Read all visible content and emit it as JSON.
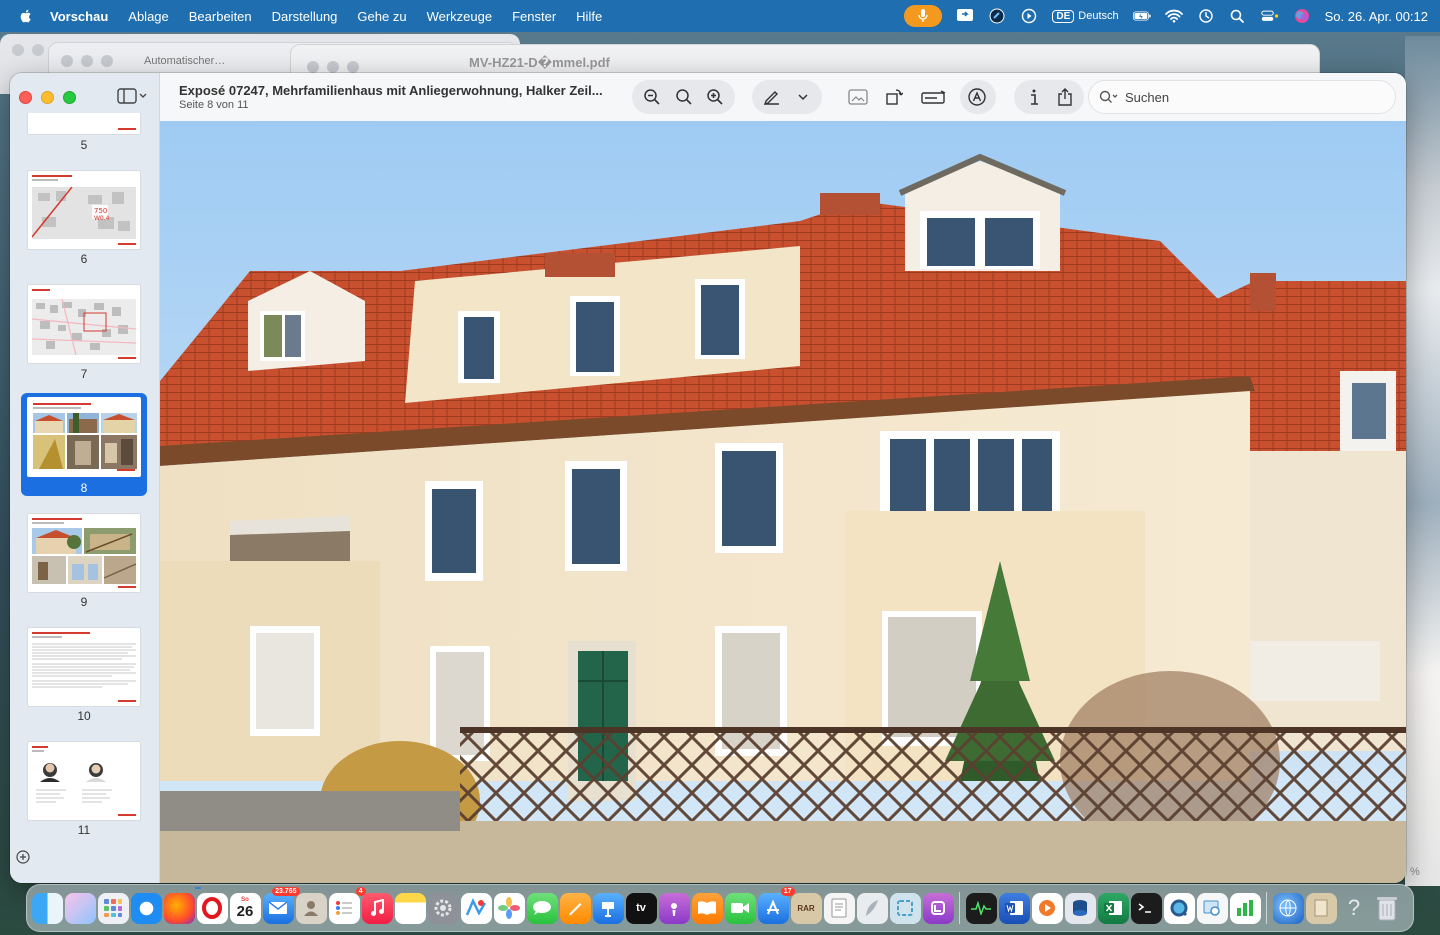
{
  "menubar": {
    "app_name": "Vorschau",
    "items": [
      "Ablage",
      "Bearbeiten",
      "Darstellung",
      "Gehe zu",
      "Werkzeuge",
      "Fenster",
      "Hilfe"
    ],
    "input_badge": "DE",
    "input_language": "Deutsch",
    "clock": "So. 26. Apr.  00:12"
  },
  "background_windows": {
    "window1_title": "Automatischer…",
    "window2_title": "MV-HZ21-D�mmel.pdf",
    "zoom_percent": "%"
  },
  "document": {
    "title": "Exposé 07247, Mehrfamilienhaus mit Anliegerwohnung, Halker Zeil...",
    "page_info": "Seite 8 von 11"
  },
  "toolbar": {
    "search_placeholder": "Suchen"
  },
  "sidebar": {
    "pages": [
      {
        "number": "5",
        "selected": false
      },
      {
        "number": "6",
        "selected": false
      },
      {
        "number": "7",
        "selected": false
      },
      {
        "number": "8",
        "selected": true
      },
      {
        "number": "9",
        "selected": false
      },
      {
        "number": "10",
        "selected": false
      },
      {
        "number": "11",
        "selected": false
      }
    ]
  },
  "dock": {
    "calendar_month": "So",
    "calendar_day": "26",
    "mail_badge": "23.765",
    "reminders_badge": "4",
    "appstore_badge": "17",
    "tv_label": "tv",
    "archive_label": "RAR"
  },
  "colors": {
    "accent": "#1c6fe0",
    "menubar": "#1f6fb0",
    "roof": "#c8502f",
    "facade": "#f1e3c6"
  }
}
